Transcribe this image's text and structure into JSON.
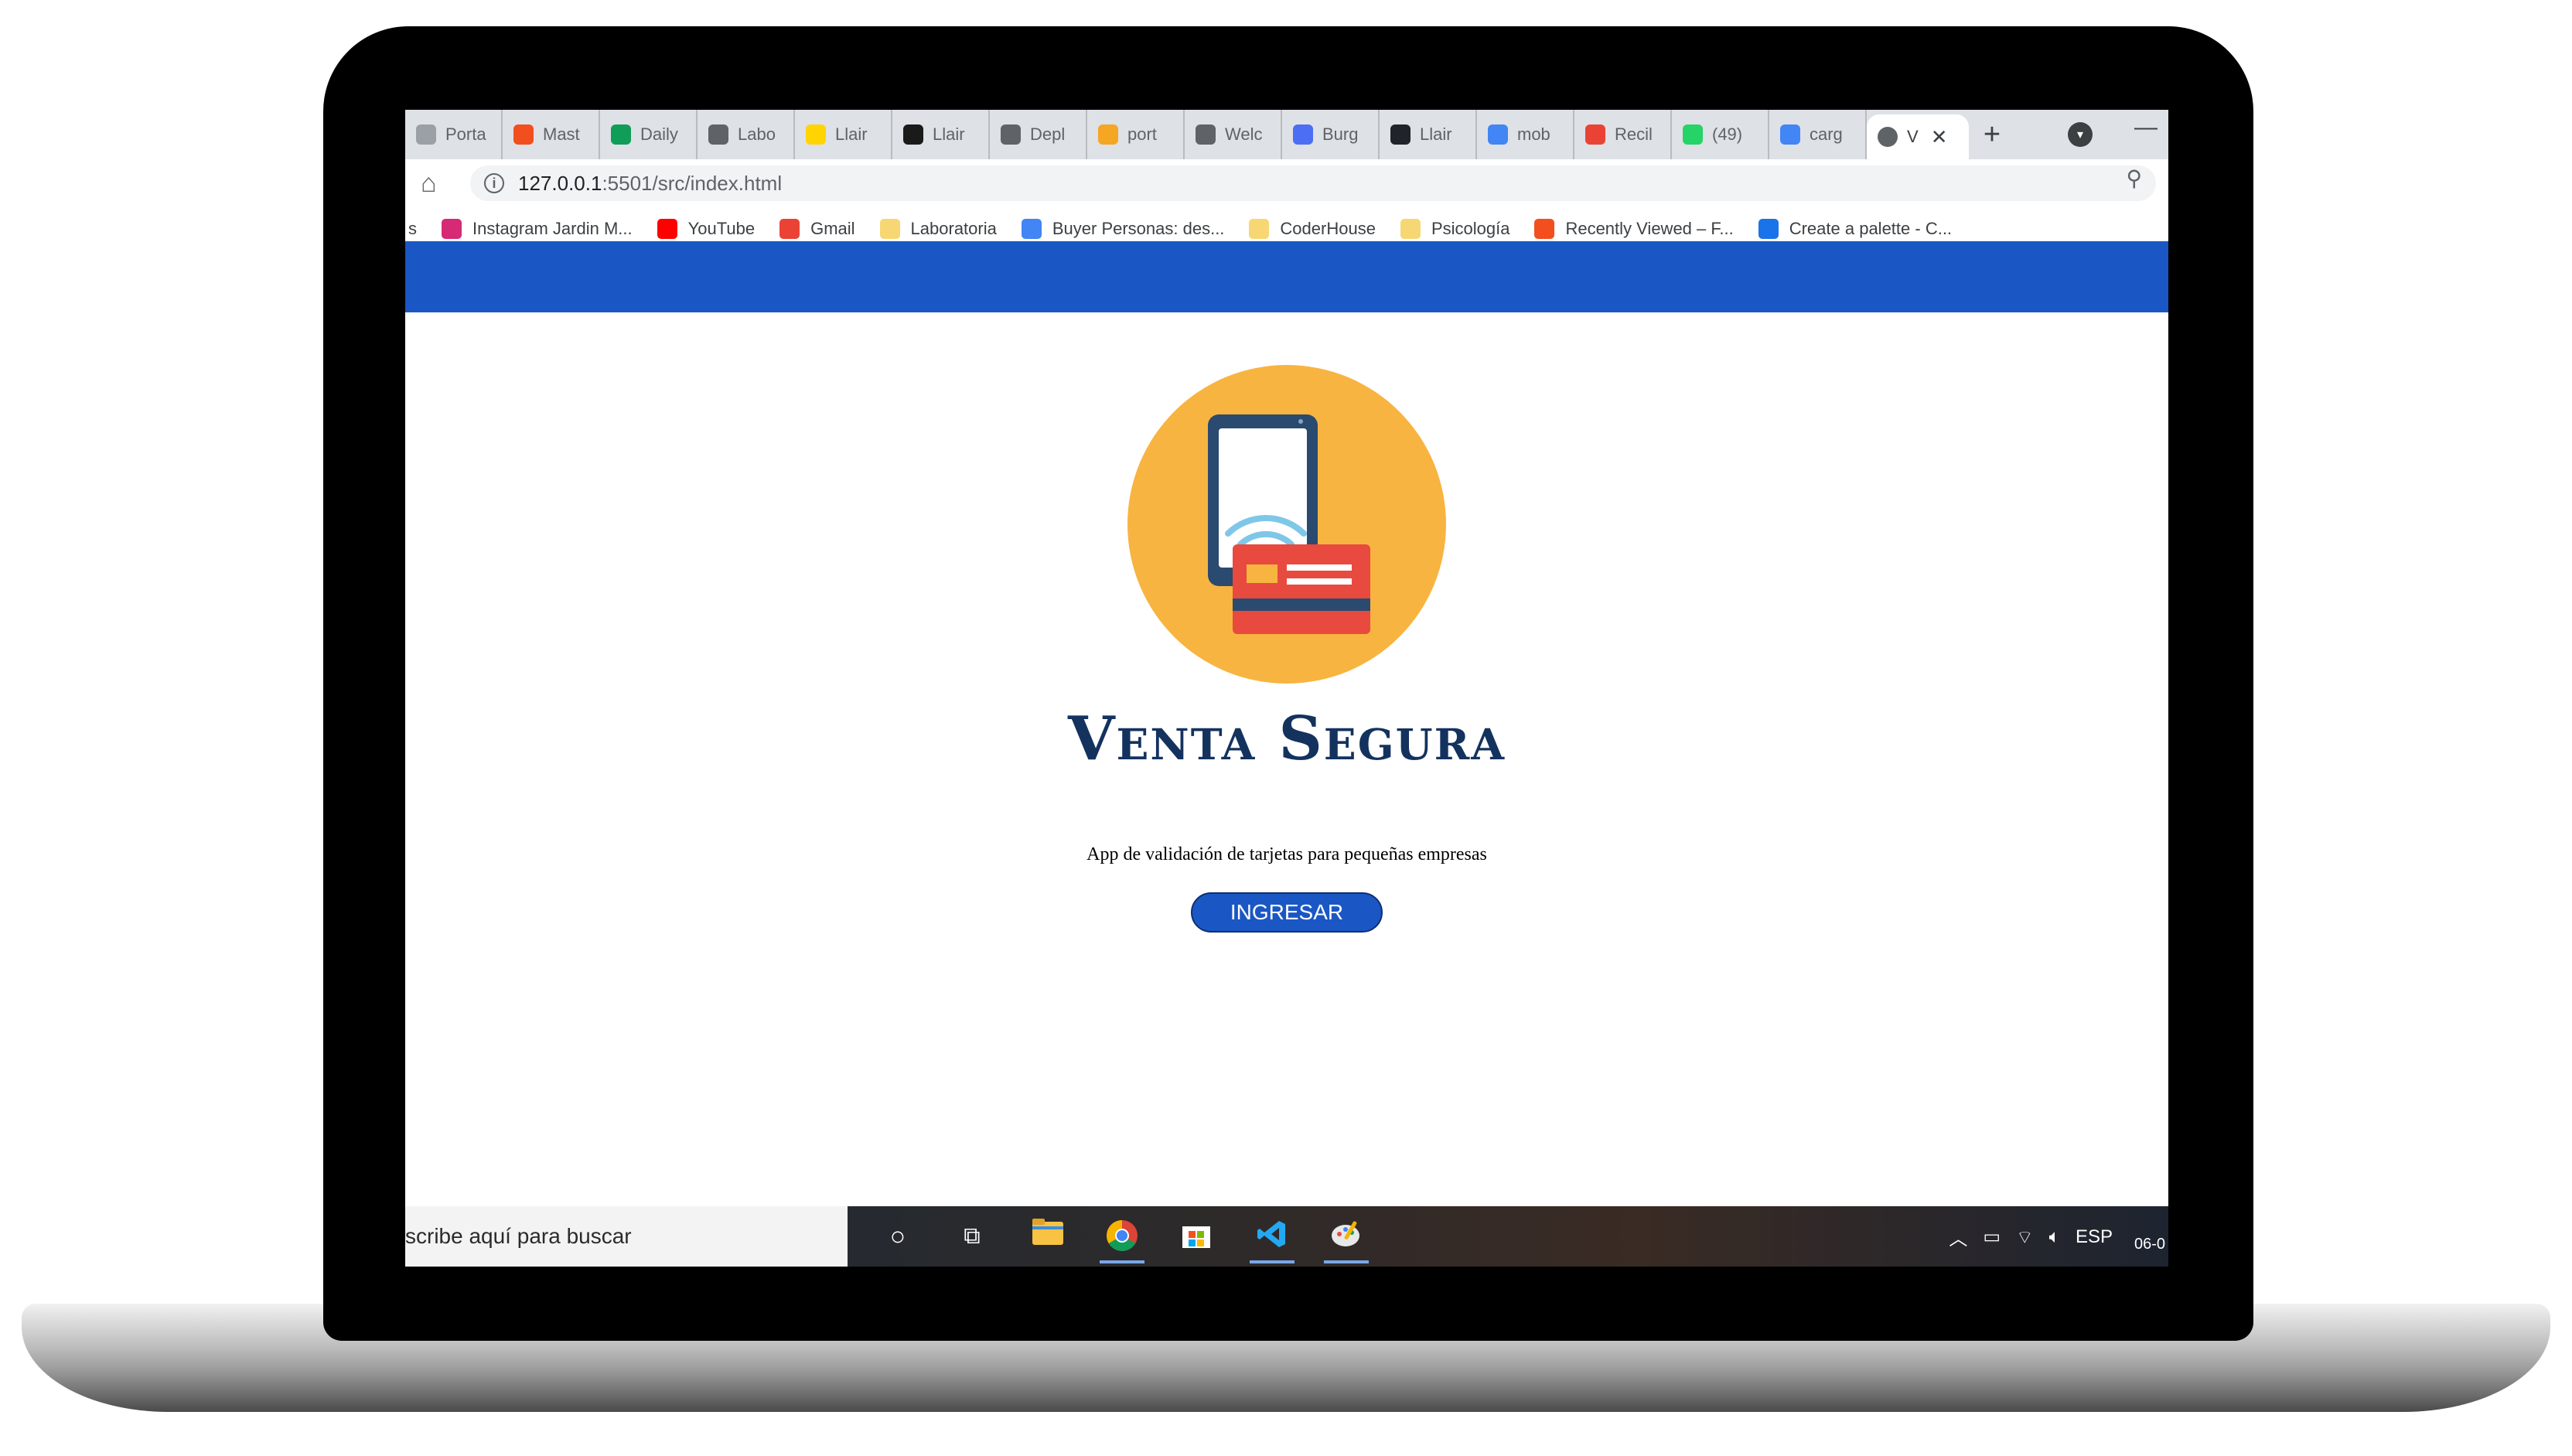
{
  "browser": {
    "tabs": [
      {
        "title": "Porta",
        "color": "#9aa0a6"
      },
      {
        "title": "Mast",
        "color": "#f24e1e"
      },
      {
        "title": "Daily",
        "color": "#0f9d58"
      },
      {
        "title": "Labo",
        "color": "#5f6368"
      },
      {
        "title": "Llair",
        "color": "#ffd400"
      },
      {
        "title": "Llair",
        "color": "#1a1a1a"
      },
      {
        "title": "Depl",
        "color": "#5f6368"
      },
      {
        "title": "port",
        "color": "#f5a623"
      },
      {
        "title": "Welc",
        "color": "#5f6368"
      },
      {
        "title": "Burg",
        "color": "#4c6ef5"
      },
      {
        "title": "Llair",
        "color": "#20232a"
      },
      {
        "title": "mob",
        "color": "#4285f4"
      },
      {
        "title": "Recil",
        "color": "#ea4335"
      },
      {
        "title": "(49)",
        "color": "#25d366"
      },
      {
        "title": "carg",
        "color": "#4285f4"
      }
    ],
    "active_tab": {
      "title": "V",
      "close": "✕"
    },
    "new_tab": "+",
    "minimize": "—",
    "url_host": "127.0.0.1",
    "url_path": ":5501/src/index.html",
    "bookmarks": [
      {
        "label": "s",
        "icon": "none",
        "color": "#ffffff"
      },
      {
        "label": "Instagram Jardin M...",
        "icon": "instagram-icon",
        "color": "#d62976"
      },
      {
        "label": "YouTube",
        "icon": "youtube-icon",
        "color": "#ff0000"
      },
      {
        "label": "Gmail",
        "icon": "gmail-icon",
        "color": "#ea4335"
      },
      {
        "label": "Laboratoria",
        "icon": "folder-icon",
        "color": "#f7d774"
      },
      {
        "label": "Buyer Personas: des...",
        "icon": "doc-icon",
        "color": "#4285f4"
      },
      {
        "label": "CoderHouse",
        "icon": "folder-icon",
        "color": "#f7d774"
      },
      {
        "label": "Psicología",
        "icon": "folder-icon",
        "color": "#f7d774"
      },
      {
        "label": "Recently Viewed – F...",
        "icon": "figma-icon",
        "color": "#f24e1e"
      },
      {
        "label": "Create a palette - C...",
        "icon": "coolors-icon",
        "color": "#1a73e8"
      }
    ]
  },
  "page": {
    "navbar_color": "#1a57c4",
    "brand": "Venta Segura",
    "tagline": "App de validación de tarjetas para pequeñas empresas",
    "cta_label": "INGRESAR",
    "logo_colors": {
      "circle": "#f8b440",
      "phone": "#2b4a6f",
      "card": "#e84a3f",
      "wifi": "#7fc7e8"
    }
  },
  "taskbar": {
    "search_placeholder": "scribe aquí para buscar",
    "apps": [
      "cortana-icon",
      "task-view-icon",
      "file-explorer-icon",
      "chrome-icon",
      "store-icon",
      "vscode-icon",
      "paint-icon"
    ],
    "language": "ESP",
    "date": "06-0"
  }
}
